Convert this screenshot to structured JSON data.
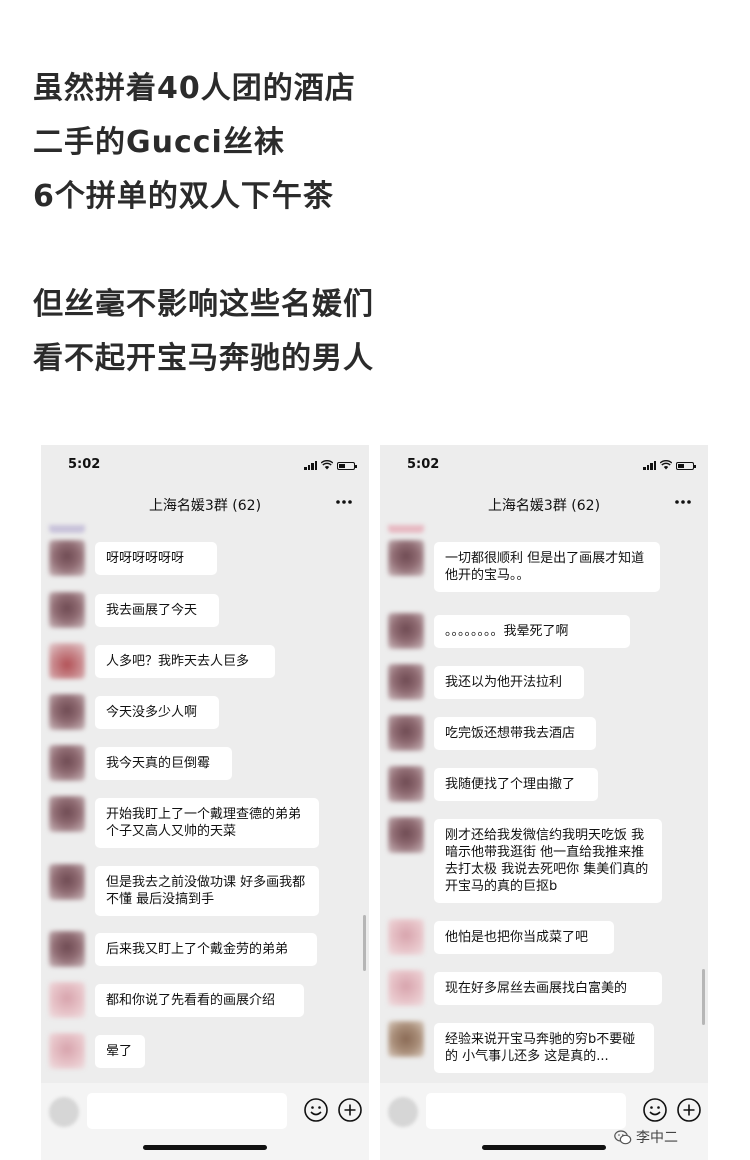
{
  "caption": {
    "lines": [
      "虽然拼着40人团的酒店",
      "二手的Gucci丝袜",
      "6个拼单的双人下午茶",
      "",
      "但丝毫不影响这些名媛们",
      "看不起开宝马奔驰的男人"
    ]
  },
  "phones": [
    {
      "status": {
        "time": "5:02"
      },
      "header": {
        "title": "上海名媛3群 (62)"
      },
      "messages": [
        "呀呀呀呀呀呀",
        "我去画展了今天",
        "人多吧？我昨天去人巨多",
        "今天没多少人啊",
        "我今天真的巨倒霉",
        "开始我盯上了一个戴理查德的弟弟 个子又高人又帅的天菜",
        "但是我去之前没做功课 好多画我都不懂 最后没搞到手",
        "后来我又盯上了个戴金劳的弟弟",
        "都和你说了先看看的画展介绍",
        "晕了"
      ]
    },
    {
      "status": {
        "time": "5:02"
      },
      "header": {
        "title": "上海名媛3群 (62)"
      },
      "messages": [
        "一切都很顺利 但是出了画展才知道他开的宝马。。",
        "。。。。。。。。我晕死了啊",
        "我还以为他开法拉利",
        "吃完饭还想带我去酒店",
        "我随便找了个理由撤了",
        "刚才还给我发微信约我明天吃饭 我暗示他带我逛街 他一直给我推来推去打太极 我说去死吧你 集美们真的 开宝马的真的巨抠b",
        "他怕是也把你当成菜了吧",
        "现在好多屌丝去画展找白富美的",
        "经验来说开宝马奔驰的穷b不要碰的 小气事儿还多 这是真的..."
      ]
    }
  ],
  "watermark": {
    "text": "李中二",
    "icon": "wechat-icon"
  },
  "colors": {
    "chat_bg": "#ededed",
    "bubble": "#ffffff",
    "text": "#111111"
  }
}
